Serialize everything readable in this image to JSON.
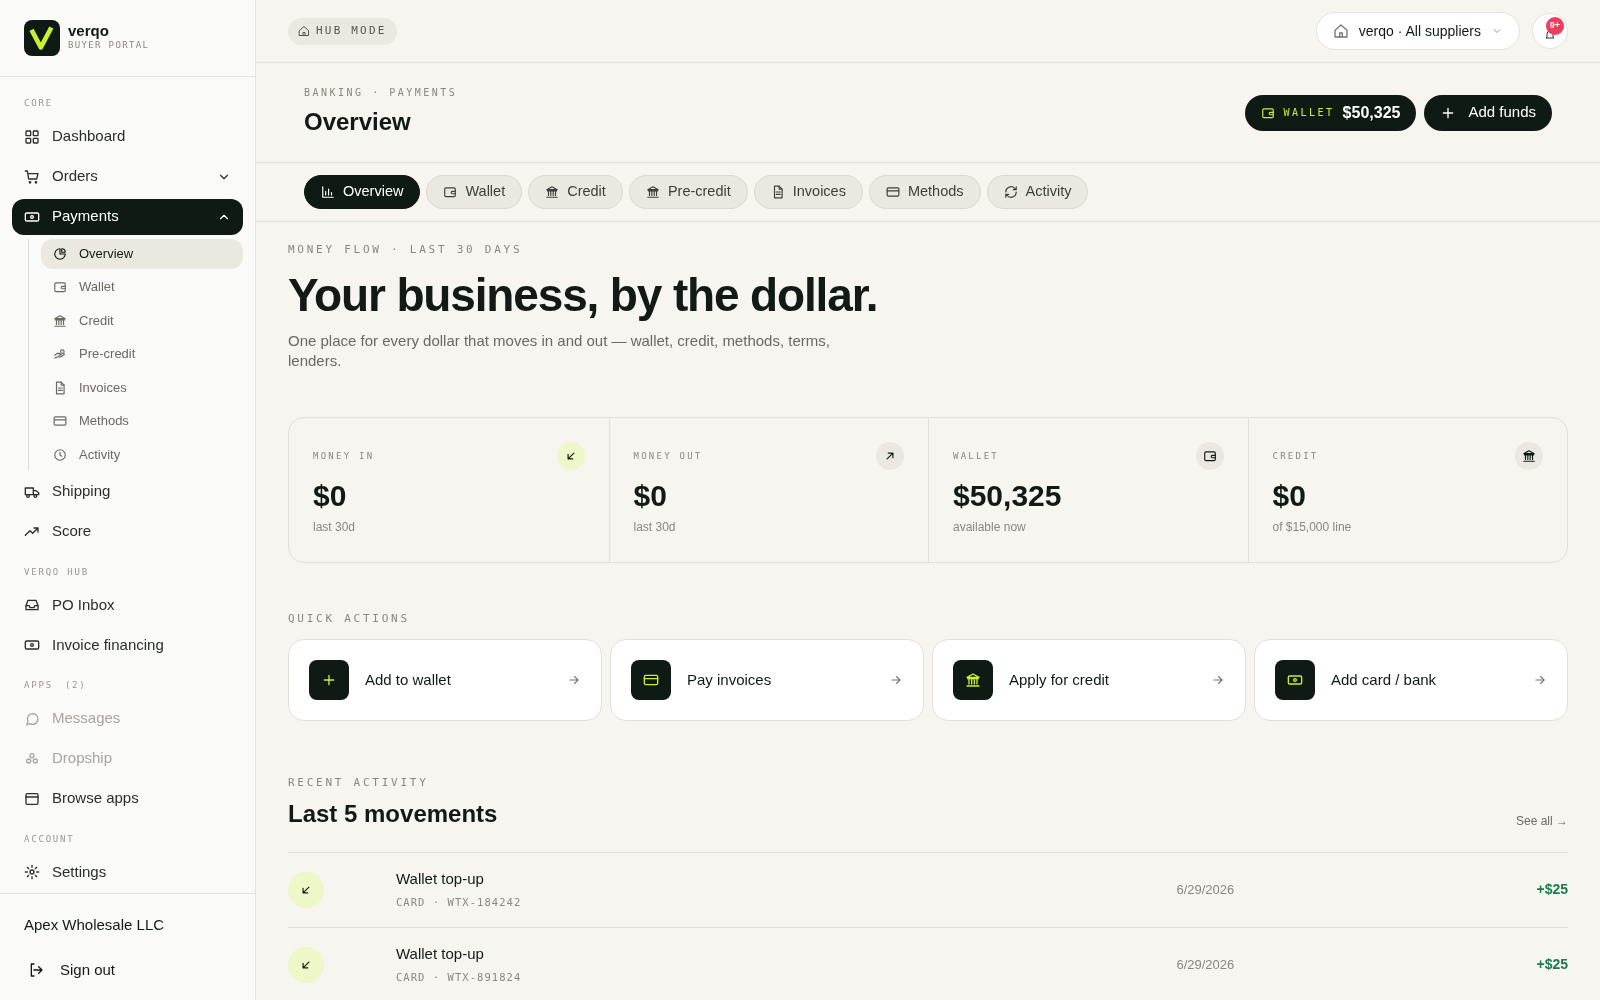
{
  "sidebar": {
    "brand": "verqo",
    "subtitle": "BUYER PORTAL",
    "sections": [
      {
        "label": "CORE",
        "items": [
          {
            "label": "Dashboard",
            "selected": false,
            "disabled": false
          },
          {
            "label": "Orders",
            "selected": false,
            "disabled": false,
            "expanded": false
          },
          {
            "label": "Payments",
            "selected": true,
            "disabled": false,
            "expanded": true,
            "children": [
              {
                "label": "Overview",
                "selected": true
              },
              {
                "label": "Wallet",
                "selected": false
              },
              {
                "label": "Credit",
                "selected": false
              },
              {
                "label": "Pre-credit",
                "selected": false
              },
              {
                "label": "Invoices",
                "selected": false
              },
              {
                "label": "Methods",
                "selected": false
              },
              {
                "label": "Activity",
                "selected": false
              }
            ]
          },
          {
            "label": "Shipping",
            "selected": false,
            "disabled": false
          },
          {
            "label": "Score",
            "selected": false,
            "disabled": false
          }
        ]
      },
      {
        "label": "VERQO HUB",
        "items": [
          {
            "label": "PO Inbox",
            "selected": false,
            "disabled": false
          },
          {
            "label": "Invoice financing",
            "selected": false,
            "disabled": false
          }
        ]
      },
      {
        "label": "APPS",
        "count": "(2)",
        "items": [
          {
            "label": "Messages",
            "selected": false,
            "disabled": true
          },
          {
            "label": "Dropship",
            "selected": false,
            "disabled": true
          },
          {
            "label": "Browse apps",
            "selected": false,
            "disabled": false
          }
        ]
      },
      {
        "label": "ACCOUNT",
        "items": [
          {
            "label": "Settings",
            "selected": false,
            "disabled": false
          }
        ]
      }
    ],
    "company": "Apex Wholesale LLC",
    "sign_out": "Sign out"
  },
  "topbar": {
    "mode": "HUB MODE",
    "supplier": "verqo · All suppliers",
    "notifications": "9+"
  },
  "header": {
    "breadcrumb": "BANKING · PAYMENTS",
    "title": "Overview",
    "wallet_label": "WALLET",
    "wallet_amount": "$50,325",
    "add_funds": "Add funds"
  },
  "tabs": [
    {
      "label": "Overview",
      "selected": true
    },
    {
      "label": "Wallet",
      "selected": false
    },
    {
      "label": "Credit",
      "selected": false
    },
    {
      "label": "Pre-credit",
      "selected": false
    },
    {
      "label": "Invoices",
      "selected": false
    },
    {
      "label": "Methods",
      "selected": false
    },
    {
      "label": "Activity",
      "selected": false
    }
  ],
  "hero": {
    "eyebrow": "MONEY FLOW · LAST 30 DAYS",
    "headline": "Your business, by the dollar.",
    "description": "One place for every dollar that moves in and out — wallet, credit, methods, terms, lenders."
  },
  "stats": [
    {
      "label": "MONEY IN",
      "value": "$0",
      "note": "last 30d",
      "highlight": true
    },
    {
      "label": "MONEY OUT",
      "value": "$0",
      "note": "last 30d",
      "highlight": false
    },
    {
      "label": "WALLET",
      "value": "$50,325",
      "note": "available now",
      "highlight": false
    },
    {
      "label": "CREDIT",
      "value": "$0",
      "note": "of $15,000 line",
      "highlight": false
    }
  ],
  "quick_actions": {
    "label": "QUICK ACTIONS",
    "items": [
      {
        "label": "Add to wallet"
      },
      {
        "label": "Pay invoices"
      },
      {
        "label": "Apply for credit"
      },
      {
        "label": "Add card / bank"
      }
    ]
  },
  "recent": {
    "label": "RECENT ACTIVITY",
    "title": "Last 5 movements",
    "see_all": "See all →",
    "rows": [
      {
        "title": "Wallet top-up",
        "meta": "CARD · WTX-184242",
        "date": "6/29/2026",
        "amount": "+$25"
      },
      {
        "title": "Wallet top-up",
        "meta": "CARD · WTX-891824",
        "date": "6/29/2026",
        "amount": "+$25"
      }
    ]
  }
}
